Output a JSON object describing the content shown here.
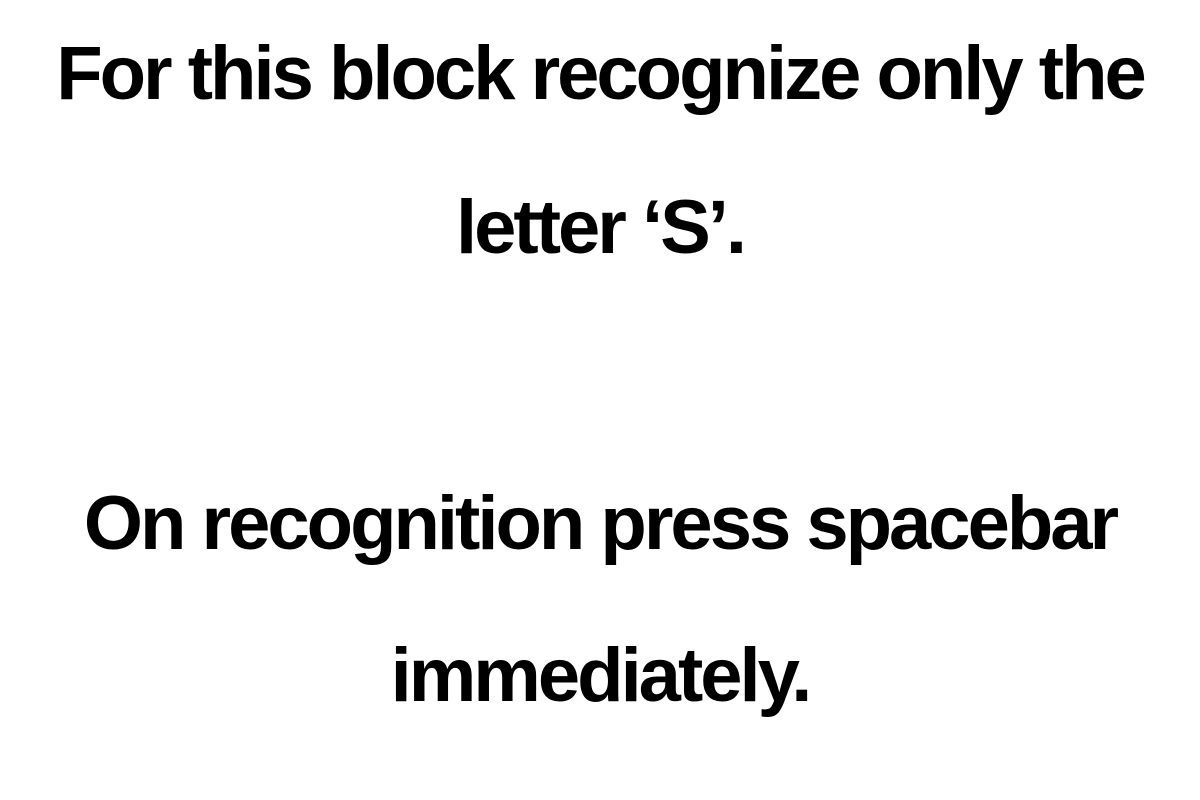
{
  "instructions": {
    "block_line_1": "For this block recognize only the",
    "block_line_2": "letter ‘S’.",
    "response_line_1": "On recognition press spacebar",
    "response_line_2": "immediately."
  },
  "colors": {
    "background": "#ffffff",
    "text": "#000000"
  }
}
